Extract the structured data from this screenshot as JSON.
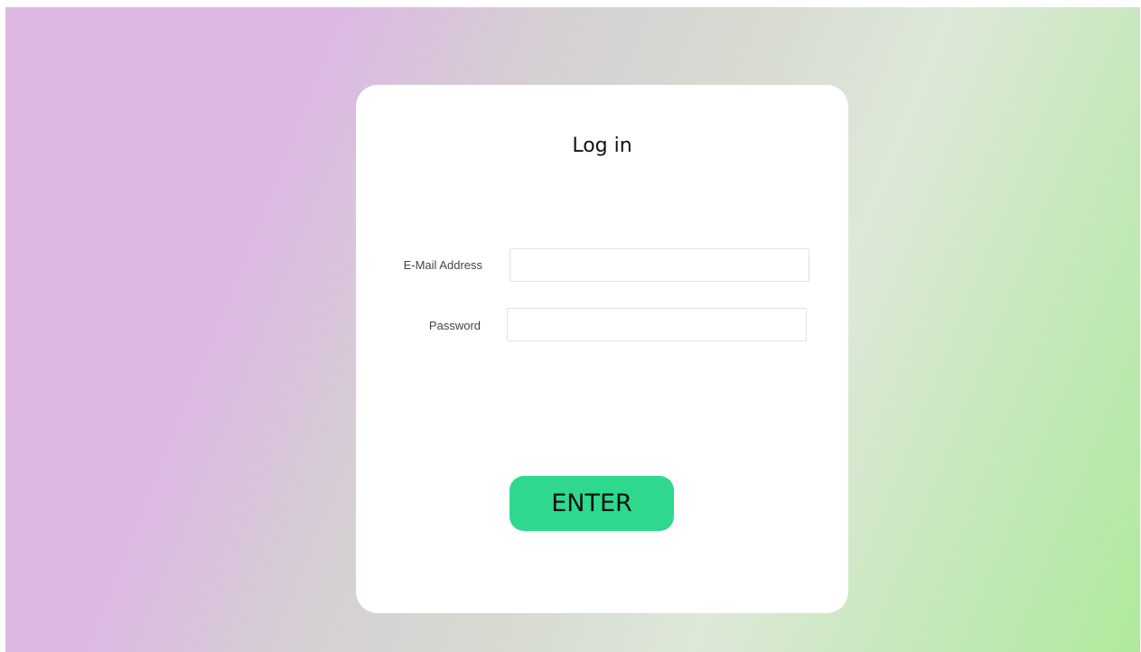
{
  "login": {
    "title": "Log in",
    "email": {
      "label": "E-Mail Address",
      "value": "",
      "placeholder": ""
    },
    "password": {
      "label": "Password",
      "value": "",
      "placeholder": ""
    },
    "submit_label": "ENTER"
  },
  "colors": {
    "button_accent": "#2ed98e",
    "background_left": "#dcb8e3",
    "background_right": "#aeea9c",
    "card": "#ffffff"
  }
}
